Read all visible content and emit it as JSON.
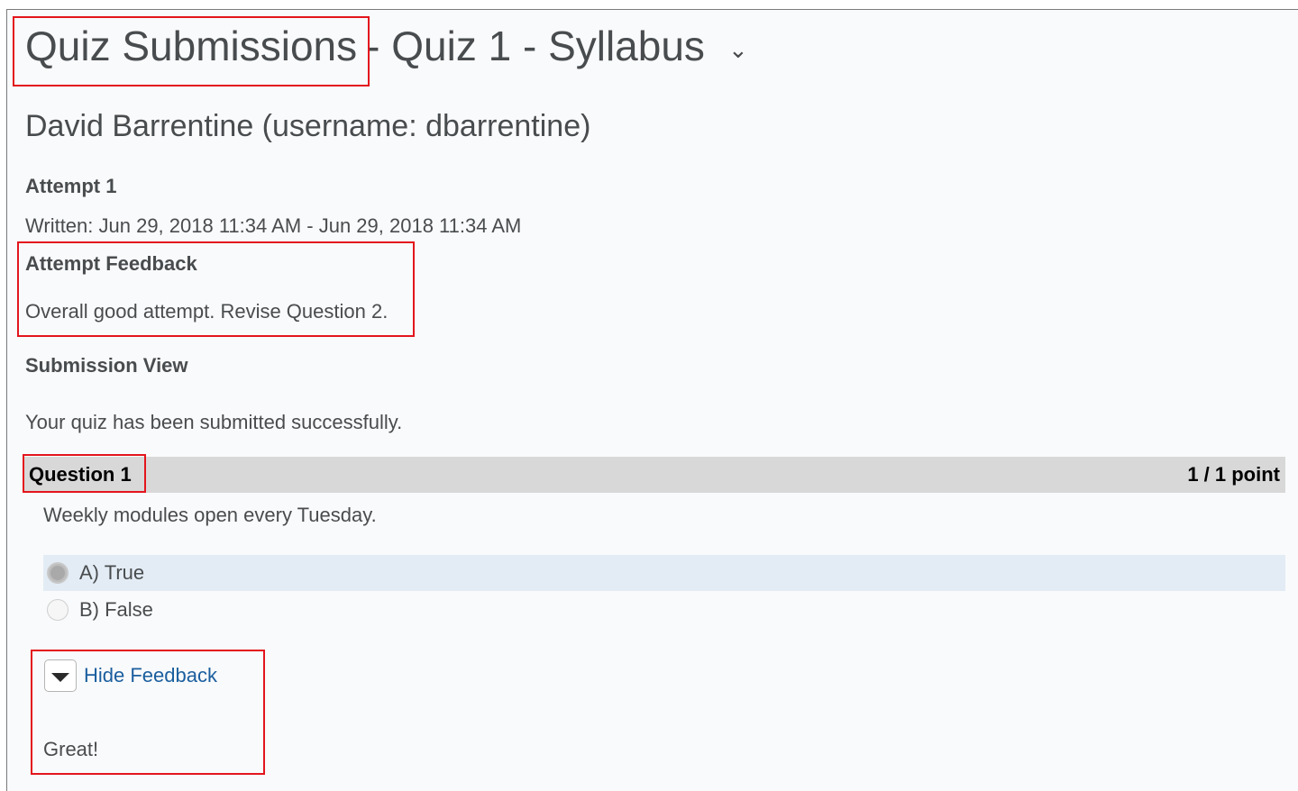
{
  "header": {
    "title_main": "Quiz Submissions",
    "title_rest": "- Quiz 1 - Syllabus",
    "menu_chevron": "⌄"
  },
  "student": {
    "name_line": "David Barrentine (username: dbarrentine)"
  },
  "attempt": {
    "label": "Attempt 1",
    "written": "Written: Jun 29, 2018 11:34 AM - Jun 29, 2018 11:34 AM",
    "feedback_heading": "Attempt Feedback",
    "feedback_text": "Overall good attempt.  Revise Question 2."
  },
  "submission": {
    "heading": "Submission View",
    "message": "Your quiz has been submitted successfully."
  },
  "question": {
    "label": "Question 1",
    "points": "1 / 1 point",
    "text": "Weekly modules open every Tuesday.",
    "options": [
      {
        "label": "A) True",
        "selected": true
      },
      {
        "label": "B) False",
        "selected": false
      }
    ],
    "feedback_toggle_label": "Hide Feedback",
    "feedback_text": "Great!"
  },
  "colors": {
    "highlight": "#e3151d",
    "link": "#1a5e9e",
    "question_bar": "#d8d8d8",
    "selected_row": "#e3ecf5"
  },
  "icons": {
    "title_menu": "chevron-down-icon",
    "feedback_toggle": "caret-down-icon"
  }
}
